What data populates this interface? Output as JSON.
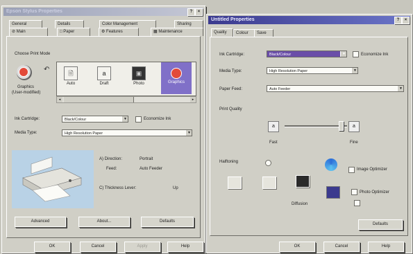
{
  "colors": {
    "titlebar_active": "#3b3a8e",
    "selection": "#6a4ea8",
    "mode_selected": "#8070c8"
  },
  "left": {
    "title": "Epson Stylus Properties",
    "tabs_row1": [
      "General",
      "Details",
      "Color Management",
      "Sharing"
    ],
    "tabs_row2": [
      "Main",
      "Paper",
      "Features",
      "Maintenance"
    ],
    "choose_mode": "Choose Print Mode",
    "modes": [
      "Auto",
      "Draft",
      "Photo",
      "Graphics"
    ],
    "side_mode": "Graphics",
    "side_mode2": "(User-modified)",
    "ink_label": "Ink Cartridge:",
    "ink_value": "Black/Colour",
    "economize_label": "Economize Ink",
    "media_label": "Media Type:",
    "media_value": "High Resolution Paper",
    "info": [
      {
        "key": "A) Direction:",
        "value": "Portrait"
      },
      {
        "key": "Feed:",
        "value": "Auto Feeder"
      },
      {
        "key": "C) Thickness Lever:",
        "value": "Up"
      }
    ],
    "buttons": [
      "Advanced",
      "About...",
      "Defaults"
    ],
    "bottom_buttons": [
      "OK",
      "Cancel",
      "Apply",
      "Help"
    ]
  },
  "right": {
    "title": "Untitled Properties",
    "tabs": [
      "Quality",
      "Colour",
      "Save"
    ],
    "ink_label": "Ink Cartridge:",
    "ink_value": "Black/Colour",
    "economize_label": "Economize Ink",
    "media_label": "Media Type:",
    "media_value": "High Resolution Paper",
    "feed_label": "Paper Feed:",
    "feed_value": "Auto Feeder",
    "print_quality": "Print Quality",
    "slider_left": "Fast",
    "slider_right": "Fine",
    "halftoning": "Halftoning",
    "diffusion": "Diffusion",
    "image_optimizer": "Image Optimizer",
    "photo_optimizer": "Photo Optimizer",
    "defaults": "Defaults",
    "bottom_buttons": [
      "OK",
      "Cancel",
      "Help"
    ]
  }
}
